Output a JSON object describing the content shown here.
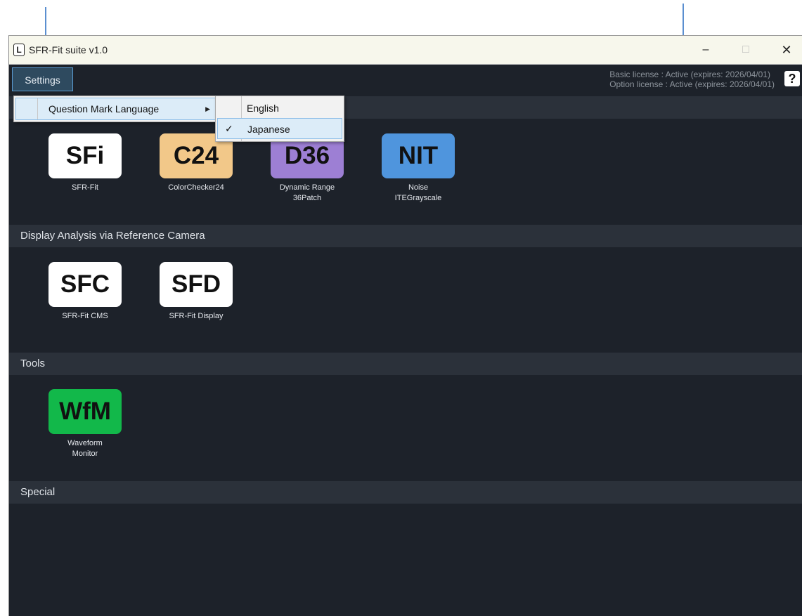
{
  "window": {
    "title": "SFR-Fit suite v1.0",
    "app_icon_letter": "L",
    "minimize": "–",
    "maximize": "□",
    "close": "✕"
  },
  "menubar": {
    "settings_label": "Settings",
    "license_basic": "Basic license : Active (expires: 2026/04/01)",
    "license_option": "Option license : Active (expires: 2026/04/01)",
    "help_label": "?"
  },
  "dropdown": {
    "item_label": "Question Mark Language",
    "submenu_arrow": "▶",
    "languages": [
      "English",
      "Japanese"
    ],
    "checked": "Japanese",
    "check_glyph": "✓"
  },
  "sections": [
    {
      "title": "",
      "apps": [
        {
          "badge": "SFi",
          "label": "SFR-Fit",
          "color": "#ffffff"
        },
        {
          "badge": "C24",
          "label": "ColorChecker24",
          "color": "#f2c889"
        },
        {
          "badge": "D36",
          "label": "Dynamic Range\n36Patch",
          "color": "#9d7fd4"
        },
        {
          "badge": "NIT",
          "label": "Noise\nITEGrayscale",
          "color": "#4f95dd"
        }
      ]
    },
    {
      "title": "Display Analysis via Reference Camera",
      "apps": [
        {
          "badge": "SFC",
          "label": "SFR-Fit CMS",
          "color": "#ffffff"
        },
        {
          "badge": "SFD",
          "label": "SFR-Fit Display",
          "color": "#ffffff"
        }
      ]
    },
    {
      "title": "Tools",
      "apps": [
        {
          "badge": "WfM",
          "label": "Waveform\nMonitor",
          "color": "#12b84a"
        }
      ]
    },
    {
      "title": "Special",
      "apps": []
    }
  ],
  "colors": {
    "background": "#1d222a",
    "section_header": "#2b313a",
    "annotation_arrow": "#5b8fd0"
  }
}
